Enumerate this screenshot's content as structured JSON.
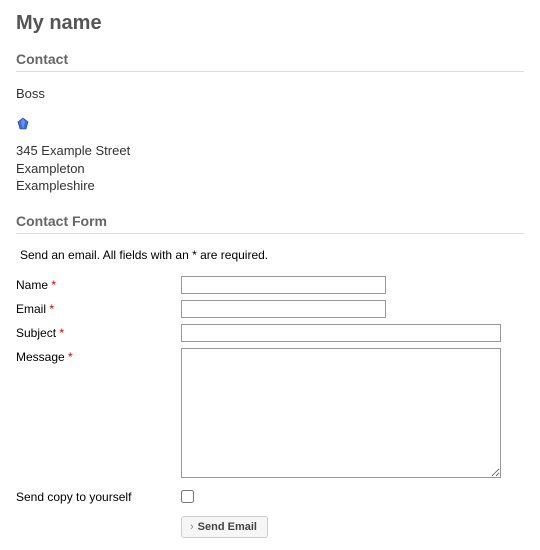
{
  "page": {
    "title": "My name"
  },
  "contact": {
    "heading": "Contact",
    "position": "Boss",
    "address": {
      "street": "345 Example Street",
      "city": "Exampleton",
      "region": "Exampleshire"
    }
  },
  "form": {
    "heading": "Contact Form",
    "instructions": "Send an email. All fields with an * are required.",
    "required_marker": "*",
    "labels": {
      "name": "Name",
      "email": "Email",
      "subject": "Subject",
      "message": "Message",
      "copy": "Send copy to yourself"
    },
    "values": {
      "name": "",
      "email": "",
      "subject": "",
      "message": ""
    },
    "submit_label": "Send Email"
  },
  "icons": {
    "gem_color": "#2a5bd7"
  }
}
